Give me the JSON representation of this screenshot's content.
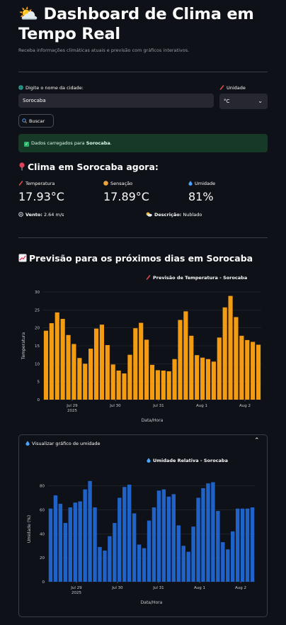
{
  "header": {
    "title_emoji": "⛅",
    "title": "Dashboard de Clima em Tempo Real",
    "subtitle": "Receba informações climáticas atuais e previsão com gráficos interativos."
  },
  "form": {
    "city_label": "Digite o nome da cidade:",
    "city_value": "Sorocaba",
    "unit_label": "Unidade",
    "unit_value": "°C",
    "search_label": "Buscar"
  },
  "alert": {
    "prefix": "Dados carregados para ",
    "city": "Sorocaba",
    "suffix": "."
  },
  "current": {
    "heading": "Clima em Sorocaba agora:",
    "temperature_label": "Temperatura",
    "temperature_value": "17.93°C",
    "feels_label": "Sensação",
    "feels_value": "17.89°C",
    "humidity_label": "Umidade",
    "humidity_value": "81%",
    "wind_label": "Vento:",
    "wind_value": "2.64 m/s",
    "desc_label": "Descrição:",
    "desc_value": "Nublado"
  },
  "forecast": {
    "heading": "Previsão para os próximos dias em Sorocaba"
  },
  "expander": {
    "label": "Visualizar gráfico de umidade",
    "chevron": "up-chevron-icon"
  },
  "colors": {
    "temperature_bar": "#f39c12",
    "humidity_bar": "#1f63c9",
    "success_bg": "#173928"
  },
  "chart_data": [
    {
      "type": "bar",
      "title": "Previsão de Temperatura - Sorocaba",
      "xlabel": "Data/Hora",
      "ylabel": "Temperatura",
      "ylim": [
        0,
        30
      ],
      "yticks": [
        0,
        5,
        10,
        15,
        20,
        25,
        30
      ],
      "xtick_labels": [
        "Jul 29",
        "Jul 30",
        "Jul 31",
        "Aug 1",
        "Aug 2"
      ],
      "xtick_sublabel": "2025",
      "values": [
        19.2,
        21.3,
        24.3,
        22.5,
        18.0,
        15.5,
        11.6,
        10.0,
        14.2,
        19.8,
        20.9,
        15.2,
        9.8,
        8.1,
        7.3,
        12.5,
        19.9,
        21.4,
        16.7,
        9.7,
        8.2,
        8.1,
        7.9,
        11.3,
        22.2,
        24.6,
        17.8,
        12.4,
        11.7,
        11.3,
        10.6,
        17.3,
        25.7,
        28.9,
        23.0,
        17.8,
        16.6,
        16.1,
        15.3
      ],
      "grid": true
    },
    {
      "type": "bar",
      "title": "Umidade Relativa - Sorocaba",
      "xlabel": "Data/Hora",
      "ylabel": "Umidade (%)",
      "ylim": [
        0,
        88
      ],
      "yticks": [
        0,
        20,
        40,
        60,
        80
      ],
      "xtick_labels": [
        "Jul 29",
        "Jul 30",
        "Jul 31",
        "Aug 1",
        "Aug 2"
      ],
      "xtick_sublabel": "2025",
      "values": [
        61,
        72,
        65,
        49,
        62,
        66,
        67,
        77,
        84,
        62,
        29,
        26,
        38,
        49,
        70,
        79,
        81,
        57,
        31,
        28,
        51,
        62,
        76,
        77,
        71,
        73,
        47,
        30,
        25,
        46,
        70,
        78,
        82,
        83,
        59,
        33,
        27,
        42,
        61,
        61,
        61,
        62
      ],
      "grid": true
    }
  ]
}
